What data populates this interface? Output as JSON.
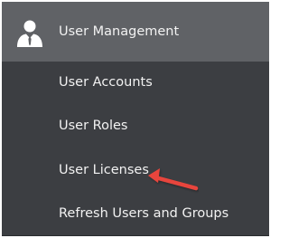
{
  "menu": {
    "header": {
      "label": "User Management",
      "icon": "user-tie-icon"
    },
    "items": [
      {
        "label": "User Accounts"
      },
      {
        "label": "User Roles"
      },
      {
        "label": "User Licenses"
      },
      {
        "label": "Refresh Users and Groups"
      }
    ]
  },
  "annotation": {
    "icon": "red-arrow-icon",
    "color": "#e8453c",
    "points_to": "User Licenses"
  },
  "colors": {
    "menu_background": "#3c3e42",
    "header_background": "#606266",
    "text": "#f2f2f2"
  }
}
